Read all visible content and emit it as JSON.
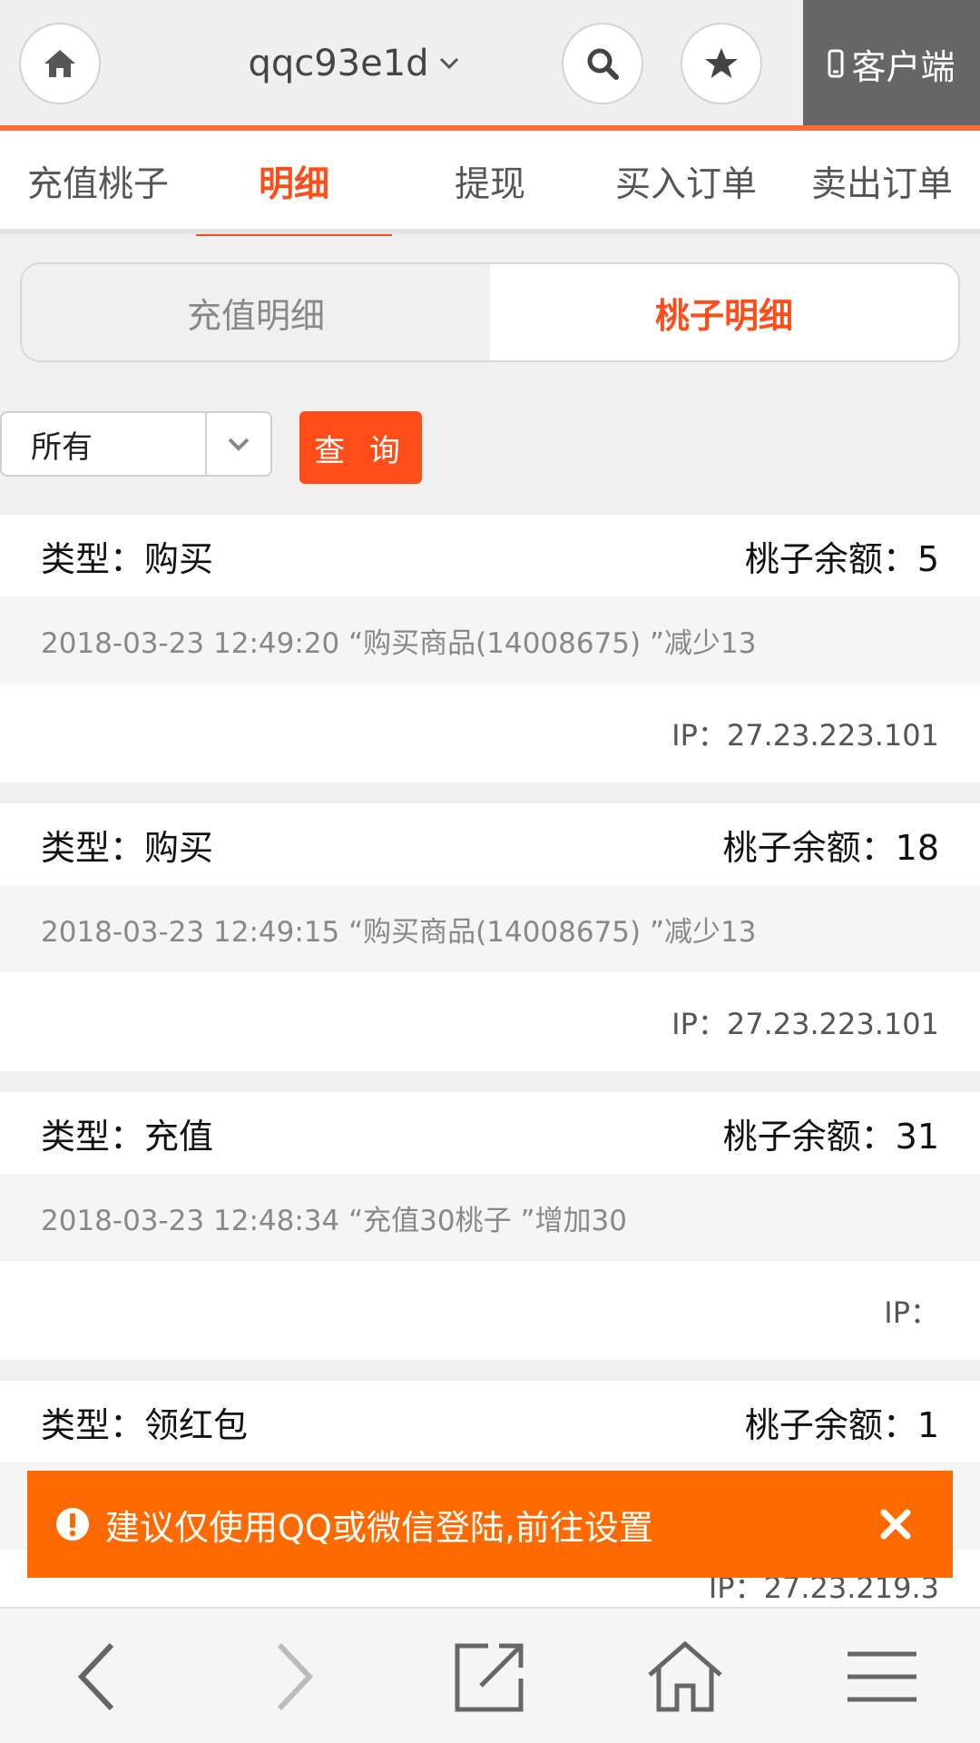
{
  "header": {
    "username": "qqc93e1d",
    "client_label": "客户端",
    "icons": {
      "home": "home-icon",
      "search": "search-icon",
      "favorite": "star-icon",
      "phone": "phone-icon"
    }
  },
  "tabs": [
    {
      "label": "充值桃子"
    },
    {
      "label": "明细"
    },
    {
      "label": "提现"
    },
    {
      "label": "买入订单"
    },
    {
      "label": "卖出订单"
    }
  ],
  "segmented": [
    {
      "label": "充值明细"
    },
    {
      "label": "桃子明细"
    }
  ],
  "filter": {
    "selected": "所有",
    "query_label": "查 询"
  },
  "records": [
    {
      "type": "类型：购买",
      "balance": "桃子余额：5",
      "desc": "2018-03-23 12:49:20 “购买商品(14008675) ”减少13",
      "ip": "IP：27.23.223.101"
    },
    {
      "type": "类型：购买",
      "balance": "桃子余额：18",
      "desc": "2018-03-23 12:49:15 “购买商品(14008675) ”减少13",
      "ip": "IP：27.23.223.101"
    },
    {
      "type": "类型：充值",
      "balance": "桃子余额：31",
      "desc": "2018-03-23 12:48:34 “充值30桃子 ”增加30",
      "ip": "IP："
    },
    {
      "type": "类型：领红包",
      "balance": "桃子余额：1",
      "desc": "",
      "ip": "IP：27.23.219.3"
    }
  ],
  "toast": {
    "message": "建议仅使用QQ或微信登陆,前往设置"
  },
  "colors": {
    "accent": "#ff4d1a",
    "toast": "#ff6a00",
    "header_line": "#ff6a3d"
  }
}
